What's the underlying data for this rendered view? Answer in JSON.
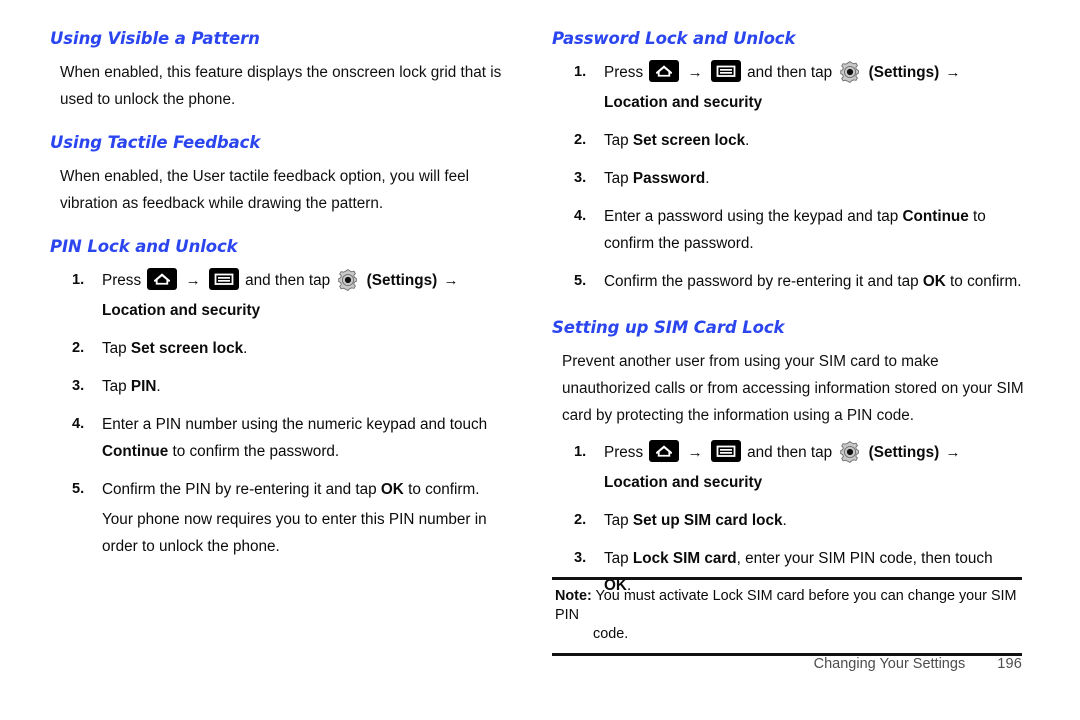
{
  "document": {
    "title": "Changing Your Settings",
    "page_number": "196",
    "heading_color": "#2b45ef"
  },
  "icons": {
    "home": "home-icon",
    "menu": "menu-icon",
    "gear": "gear-settings-icon",
    "arrow": "→"
  },
  "left_column": {
    "section1": {
      "heading": "Using Visible a Pattern",
      "paragraph": "When enabled, this feature displays the onscreen lock grid that is used to unlock the phone."
    },
    "section2": {
      "heading": "Using Tactile Feedback",
      "paragraph": "When enabled, the User tactile feedback option, you will feel vibration as feedback while drawing the pattern."
    },
    "section3": {
      "heading": "PIN Lock and Unlock",
      "steps": [
        {
          "num": "1.",
          "pre": "Press",
          "mid": "and then tap",
          "settings": "(Settings)",
          "sub_bold": "Location and security",
          "sub_tail": "."
        },
        {
          "num": "2.",
          "pre": "Tap ",
          "bold": "Set screen lock",
          "post": "."
        },
        {
          "num": "3.",
          "pre": "Tap ",
          "bold": "PIN",
          "post": "."
        },
        {
          "num": "4.",
          "pre": "Enter a PIN number using the numeric keypad and touch ",
          "bold": "Continue",
          "post": " to confirm the password."
        },
        {
          "num": "5.",
          "pre": "Confirm the PIN by re-entering it and tap ",
          "bold": "OK",
          "post": " to confirm.",
          "sub": "Your phone now requires you to enter this PIN number in order to unlock the phone."
        }
      ]
    }
  },
  "right_column": {
    "section1": {
      "heading": "Password Lock and Unlock",
      "steps": [
        {
          "num": "1.",
          "pre": "Press",
          "mid": "and then tap",
          "settings": "(Settings)",
          "sub_bold": "Location and security",
          "sub_tail": "."
        },
        {
          "num": "2.",
          "pre": "Tap ",
          "bold": "Set screen lock",
          "post": "."
        },
        {
          "num": "3.",
          "pre": "Tap ",
          "bold": "Password",
          "post": "."
        },
        {
          "num": "4.",
          "pre": "Enter a password using the keypad and tap ",
          "bold": "Continue",
          "post": " to confirm the password."
        },
        {
          "num": "5.",
          "pre": "Confirm the password by re-entering it and tap ",
          "bold": "OK",
          "post": " to confirm."
        }
      ]
    },
    "section2": {
      "heading": "Setting up SIM Card Lock",
      "paragraph": "Prevent another user from using your SIM card to make unauthorized calls or from accessing information stored on your SIM card by protecting the information using a PIN code.",
      "steps": [
        {
          "num": "1.",
          "pre": "Press",
          "mid": "and then tap",
          "settings": "(Settings)",
          "sub_bold": "Location and security",
          "sub_tail": "."
        },
        {
          "num": "2.",
          "pre": "Tap ",
          "bold": "Set up SIM card lock",
          "post": "."
        },
        {
          "num": "3.",
          "pre": "Tap ",
          "bold": "Lock SIM card",
          "post": ", enter your SIM PIN code, then touch ",
          "bold2": "OK",
          "post2": "."
        }
      ]
    }
  },
  "note": {
    "label": "Note:",
    "line1": "You must activate Lock SIM card before you can change your SIM PIN",
    "line2": "code."
  }
}
